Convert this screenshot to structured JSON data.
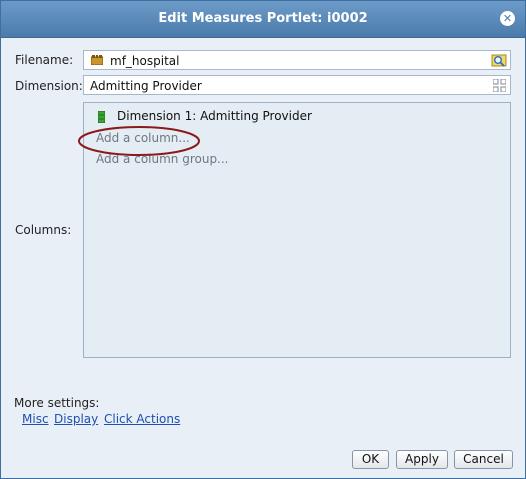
{
  "dialog": {
    "title": "Edit Measures Portlet: i0002",
    "close_icon": "close-icon"
  },
  "form": {
    "filename_label": "Filename:",
    "filename_value": "mf_hospital",
    "filename_icon": "folder-icon",
    "filename_browse_icon": "search-folder-icon",
    "dimension_label": "Dimension:",
    "dimension_value": "Admitting Provider",
    "dimension_picker_icon": "grid-icon",
    "columns_label": "Columns:"
  },
  "columns": {
    "dimension_item": "Dimension 1: Admitting Provider",
    "dimension_icon": "dimension-icon",
    "add_column": "Add a column...",
    "add_column_group": "Add a column group..."
  },
  "settings": {
    "title": "More settings:",
    "links": [
      "Misc",
      "Display",
      "Click Actions"
    ]
  },
  "buttons": {
    "ok": "OK",
    "apply": "Apply",
    "cancel": "Cancel"
  },
  "colors": {
    "titlebar": "#4a7bab",
    "background": "#e9eff6",
    "link": "#1f4fb0",
    "highlight": "#8b1a1a"
  }
}
